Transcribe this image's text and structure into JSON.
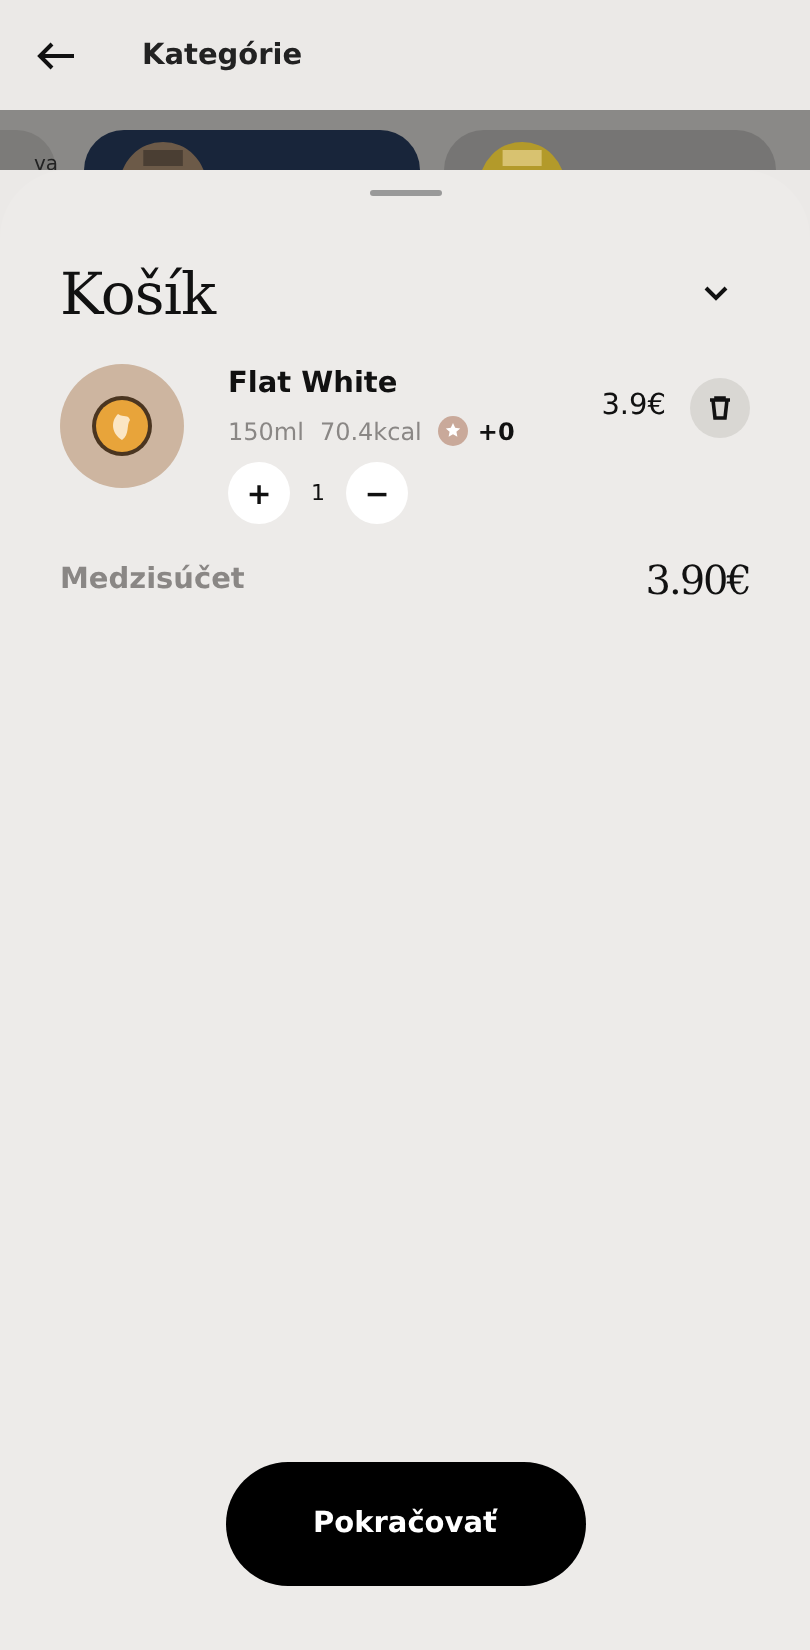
{
  "header": {
    "title": "Kategórie"
  },
  "background_categories": [
    {
      "label": "va"
    },
    {
      "kind": "picture"
    },
    {
      "kind": "picture"
    }
  ],
  "cart": {
    "title": "Košík",
    "items": [
      {
        "name": "Flat White",
        "price": "3.9€",
        "volume": "150ml",
        "energy": "70.4kcal",
        "points": "+0",
        "quantity": "1",
        "increase": "+",
        "decrease": "−"
      }
    ],
    "subtotal_label": "Medzisúčet",
    "subtotal": "3.90€"
  },
  "continue_button": "Pokračovať"
}
